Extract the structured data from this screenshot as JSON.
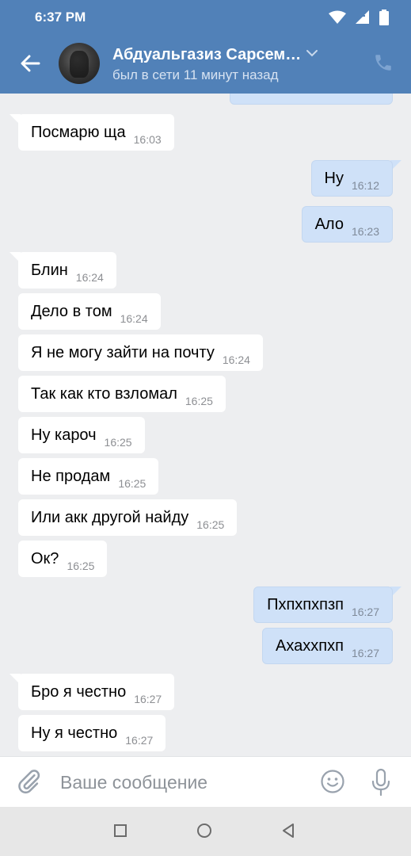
{
  "status_bar": {
    "time": "6:37 PM"
  },
  "header": {
    "contact_name": "Абдуальгазиз Сарсем…",
    "contact_status": "был в сети 11 минут назад"
  },
  "messages": [
    {
      "dir": "in",
      "text": "Посмарю ща",
      "time": "16:03"
    },
    {
      "dir": "out",
      "text": "Ну",
      "time": "16:12"
    },
    {
      "dir": "out",
      "text": "Ало",
      "time": "16:23"
    },
    {
      "dir": "in",
      "text": "Блин",
      "time": "16:24"
    },
    {
      "dir": "in",
      "text": "Дело в том",
      "time": "16:24"
    },
    {
      "dir": "in",
      "text": "Я не могу зайти на почту",
      "time": "16:24"
    },
    {
      "dir": "in",
      "text": "Так как кто взломал",
      "time": "16:25"
    },
    {
      "dir": "in",
      "text": "Ну кароч",
      "time": "16:25"
    },
    {
      "dir": "in",
      "text": "Не продам",
      "time": "16:25"
    },
    {
      "dir": "in",
      "text": "Или акк другой найду",
      "time": "16:25"
    },
    {
      "dir": "in",
      "text": "Ок?",
      "time": "16:25"
    },
    {
      "dir": "out",
      "text": "Пхпхпхпзп",
      "time": "16:27"
    },
    {
      "dir": "out",
      "text": "Ахаххпхп",
      "time": "16:27"
    },
    {
      "dir": "in",
      "text": "Бро я честно",
      "time": "16:27"
    },
    {
      "dir": "in",
      "text": "Ну я честно",
      "time": "16:27"
    }
  ],
  "composer": {
    "placeholder": "Ваше сообщение"
  },
  "icons": {
    "back": "arrow-left-icon",
    "call": "phone-icon",
    "attach": "paperclip-icon",
    "emoji": "smiley-icon",
    "mic": "microphone-icon",
    "nav_recents": "square-icon",
    "nav_home": "circle-icon",
    "nav_back": "triangle-back-icon"
  },
  "colors": {
    "header": "#5181b8",
    "chat_background": "#edeef0",
    "incoming_bubble": "#ffffff",
    "outgoing_bubble": "#cfe1f8"
  }
}
